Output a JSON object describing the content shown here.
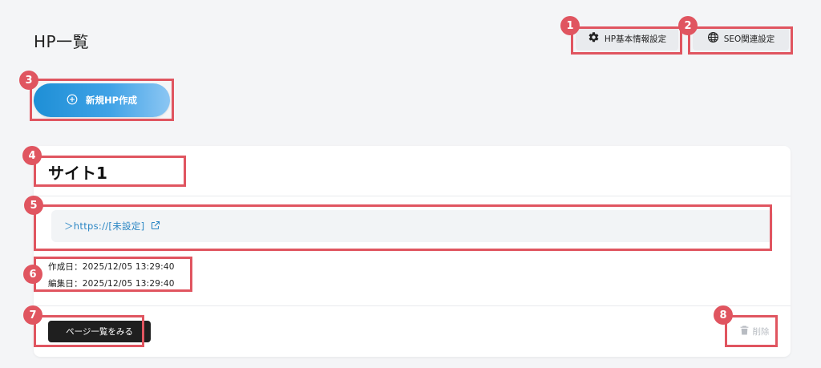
{
  "page": {
    "title": "HP一覧"
  },
  "toolbar": {
    "hp_settings_label": "HP基本情報設定",
    "seo_settings_label": "SEO関連設定"
  },
  "create": {
    "label": "新規HP作成"
  },
  "site": {
    "title": "サイト1",
    "url": "＞https://[未設定]",
    "created": "作成日：2025/12/05 13:29:40",
    "edited": "編集日：2025/12/05 13:29:40",
    "view_pages_label": "ページ一覧をみる",
    "delete_label": "削除"
  },
  "annotations": [
    "1",
    "2",
    "3",
    "4",
    "5",
    "6",
    "7",
    "8"
  ],
  "colors": {
    "annotation": "#e05560",
    "link": "#2b86c4",
    "primary_gradient_start": "#1e8fd6",
    "primary_gradient_end": "#8cc6f3"
  }
}
